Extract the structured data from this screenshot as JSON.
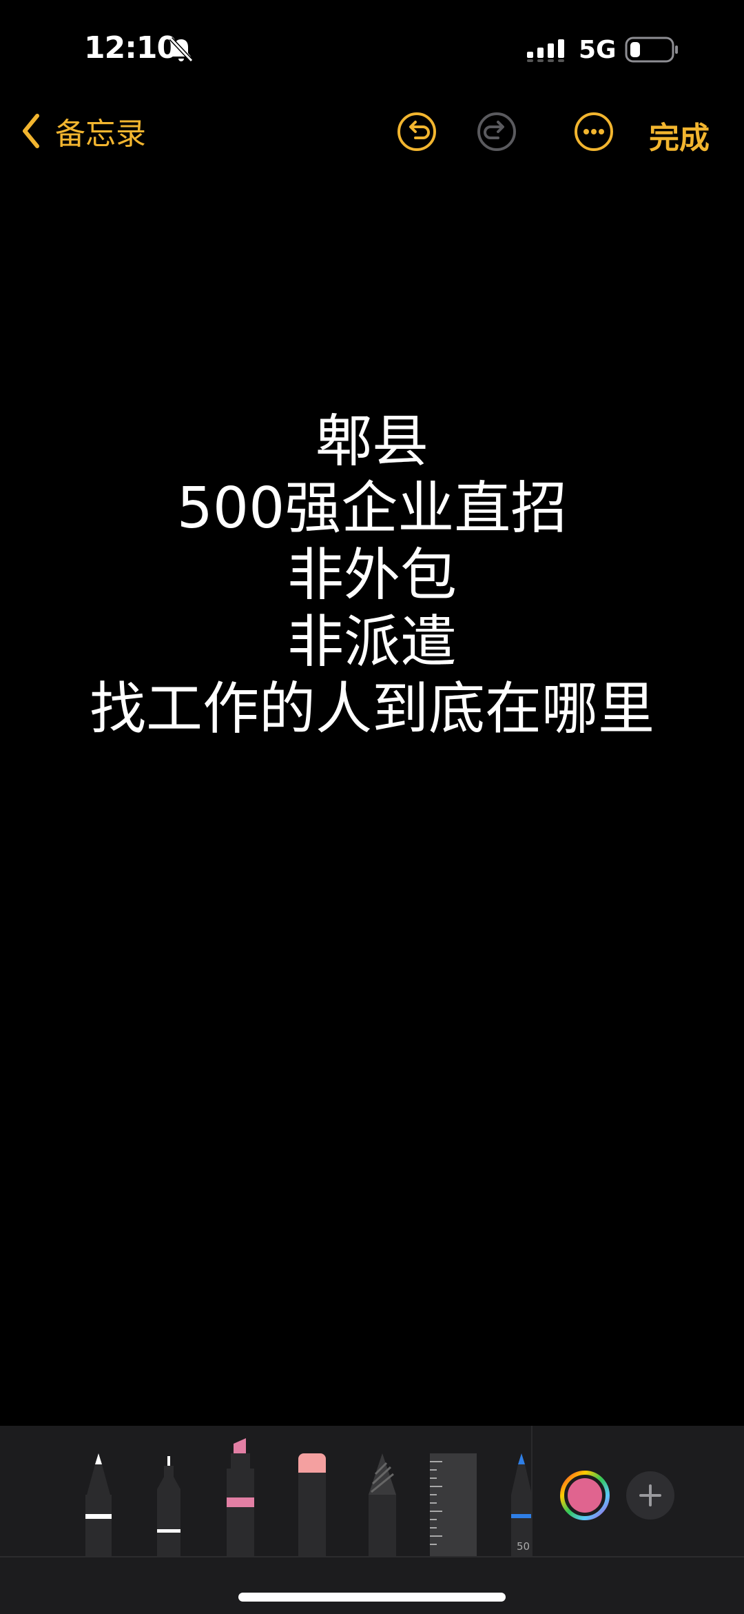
{
  "status": {
    "time": "12:10",
    "network": "5G"
  },
  "nav": {
    "back_label": "备忘录",
    "done_label": "完成"
  },
  "note": {
    "lines": [
      "郫县",
      "500强企业直招",
      "非外包",
      "非派遣",
      "找工作的人到底在哪里"
    ]
  },
  "palette": {
    "tool_size_label": "50"
  },
  "colors": {
    "accent": "#f2b52f",
    "background": "#000000",
    "toolbar": "#1c1c1e",
    "selected_color": "#e0648f"
  },
  "icons": [
    "bell-slash-icon",
    "cellular-signal-icon",
    "battery-icon",
    "chevron-left-icon",
    "undo-icon",
    "redo-icon",
    "more-icon",
    "plus-icon"
  ]
}
